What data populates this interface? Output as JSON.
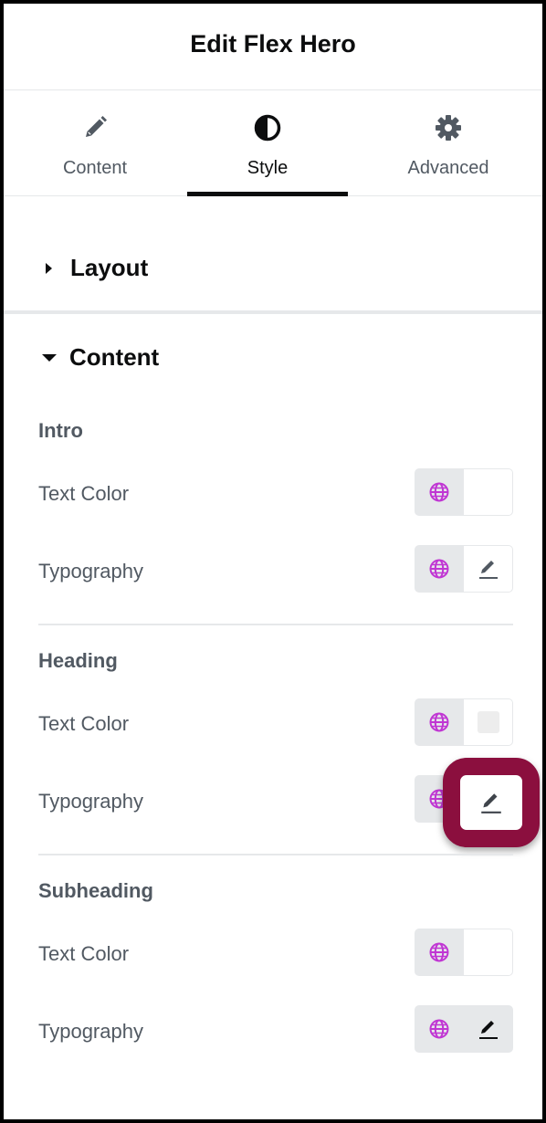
{
  "header": {
    "title": "Edit Flex Hero"
  },
  "tabs": [
    {
      "label": "Content",
      "icon": "pencil-icon"
    },
    {
      "label": "Style",
      "icon": "contrast-icon",
      "active": true
    },
    {
      "label": "Advanced",
      "icon": "gear-icon"
    }
  ],
  "sections": {
    "layout": {
      "label": "Layout",
      "expanded": false
    },
    "content": {
      "label": "Content",
      "expanded": true
    }
  },
  "groups": {
    "intro": {
      "title": "Intro",
      "text_color_label": "Text Color",
      "typography_label": "Typography"
    },
    "heading": {
      "title": "Heading",
      "text_color_label": "Text Color",
      "typography_label": "Typography"
    },
    "subheading": {
      "title": "Subheading",
      "text_color_label": "Text Color",
      "typography_label": "Typography"
    }
  },
  "colors": {
    "accent_globe": "#c036d3",
    "highlight": "#8b0f3e",
    "text_primary": "#0c0d0e",
    "text_secondary": "#515962"
  }
}
